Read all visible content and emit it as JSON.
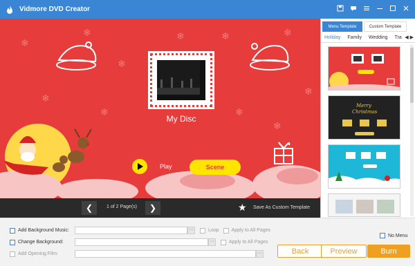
{
  "app": {
    "title": "Vidmore DVD Creator",
    "accent_color": "#3a86d4",
    "toolbar_icons": [
      "save-icon",
      "feedback-icon",
      "menu-icon",
      "minimize-icon",
      "maximize-icon",
      "close-icon"
    ]
  },
  "preview": {
    "disc_title": "My Disc",
    "play_label": "Play",
    "scene_label": "Scene",
    "background_color": "#e63c3c",
    "button_color": "#ffe400"
  },
  "navigation": {
    "page_label": "1 of 2 Page(s)",
    "save_template_label": "Save As Custom Template"
  },
  "template_panel": {
    "tabs": [
      "Menu Template",
      "Custom Template"
    ],
    "active_tab": "Menu Template",
    "categories": [
      "Holiday",
      "Family",
      "Wedding",
      "Tra"
    ],
    "active_category": "Holiday",
    "thumb_texts": {
      "christmas_line1": "Merry",
      "christmas_line2": "Christmas"
    }
  },
  "options": {
    "background_music_label": "Add Background Music:",
    "background_music_value": "",
    "loop_label": "Loop",
    "apply_all_pages_label": "Apply to All Pages",
    "change_background_label": "Change Background:",
    "change_background_value": "",
    "apply_all_pages_label_2": "Apply to All Pages",
    "opening_film_label": "Add Opening Film:",
    "opening_film_value": "",
    "no_menu_label": "No Menu",
    "browse_label": "···"
  },
  "actions": {
    "back_label": "Back",
    "preview_label": "Preview",
    "burn_label": "Burn",
    "accent_color": "#f0a020"
  }
}
